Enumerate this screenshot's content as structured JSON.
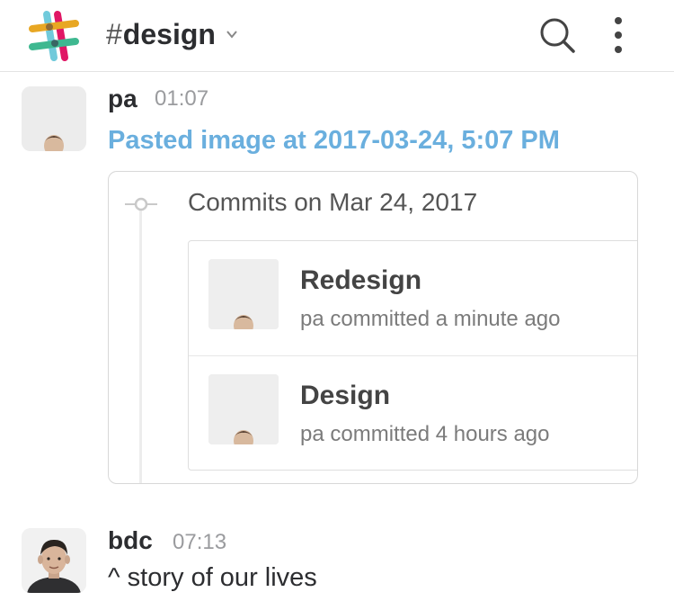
{
  "header": {
    "channel_hash": "#",
    "channel_name": "design",
    "icons": {
      "logo": "slack-logo-icon",
      "caret": "chevron-down-icon",
      "search": "search-icon",
      "more": "more-vertical-icon"
    }
  },
  "messages": [
    {
      "author": "pa",
      "time": "01:07",
      "attachment_title": "Pasted image at 2017-03-24, 5:07 PM",
      "attachment_color": "#6aafde",
      "image": {
        "heading": "Commits on Mar 24, 2017",
        "commits": [
          {
            "title": "Redesign",
            "meta": "pa committed a minute ago"
          },
          {
            "title": "Design",
            "meta": "pa committed 4 hours ago"
          }
        ]
      }
    },
    {
      "author": "bdc",
      "time": "07:13",
      "text": "^ story of our lives"
    }
  ]
}
